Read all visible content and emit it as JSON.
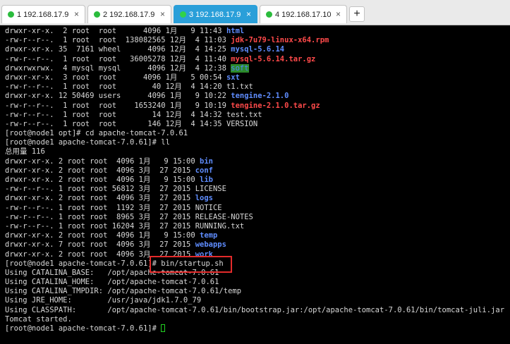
{
  "tabs": [
    {
      "label": "1 192.168.17.9",
      "active": false
    },
    {
      "label": "2 192.168.17.9",
      "active": false
    },
    {
      "label": "3 192.168.17.9",
      "active": true
    },
    {
      "label": "4 192.168.17.10",
      "active": false
    }
  ],
  "add_tab_label": "+",
  "terminal": {
    "lines": [
      {
        "text": "drwxr-xr-x.  2 root  root      4096 1月   9 11:43 ",
        "name": "html",
        "cls": "dir"
      },
      {
        "text": "-rw-r--r--.  1 root  root  138082565 12月  4 11:03 ",
        "name": "jdk-7u79-linux-x64.rpm",
        "cls": "red"
      },
      {
        "text": "drwxr-xr-x. 35  7161 wheel      4096 12月  4 14:25 ",
        "name": "mysql-5.6.14",
        "cls": "dir"
      },
      {
        "text": "-rw-r--r--.  1 root  root   36005278 12月  4 11:40 ",
        "name": "mysql-5.6.14.tar.gz",
        "cls": "red"
      },
      {
        "text": "drwxrwxrwx.  4 mysql mysql      4096 12月  4 12:38 ",
        "name": "soft",
        "cls": "softbg"
      },
      {
        "text": "drwxr-xr-x.  3 root  root      4096 1月   5 00:54 ",
        "name": "sxt",
        "cls": "dir"
      },
      {
        "text": "-rw-r--r--.  1 root  root        40 12月  4 14:20 ",
        "name": "t1.txt",
        "cls": ""
      },
      {
        "text": "drwxr-xr-x. 12 50469 users      4096 1月   9 10:22 ",
        "name": "tengine-2.1.0",
        "cls": "dir"
      },
      {
        "text": "-rw-r--r--.  1 root  root    1653240 1月   9 10:19 ",
        "name": "tengine-2.1.0.tar.gz",
        "cls": "red"
      },
      {
        "text": "-rw-r--r--.  1 root  root        14 12月  4 14:32 ",
        "name": "test.txt",
        "cls": ""
      },
      {
        "text": "-rw-r--r--.  1 root  root       146 12月  4 14:35 ",
        "name": "VERSION",
        "cls": ""
      },
      {
        "text": "[root@node1 opt]# cd apache-tomcat-7.0.61",
        "name": "",
        "cls": ""
      },
      {
        "text": "[root@node1 apache-tomcat-7.0.61]# ll",
        "name": "",
        "cls": ""
      },
      {
        "text": "总用量 116",
        "name": "",
        "cls": ""
      },
      {
        "text": "drwxr-xr-x. 2 root root  4096 1月   9 15:00 ",
        "name": "bin",
        "cls": "dir"
      },
      {
        "text": "drwxr-xr-x. 2 root root  4096 3月  27 2015 ",
        "name": "conf",
        "cls": "dir"
      },
      {
        "text": "drwxr-xr-x. 2 root root  4096 1月   9 15:00 ",
        "name": "lib",
        "cls": "dir"
      },
      {
        "text": "-rw-r--r--. 1 root root 56812 3月  27 2015 ",
        "name": "LICENSE",
        "cls": ""
      },
      {
        "text": "drwxr-xr-x. 2 root root  4096 3月  27 2015 ",
        "name": "logs",
        "cls": "dir"
      },
      {
        "text": "-rw-r--r--. 1 root root  1192 3月  27 2015 ",
        "name": "NOTICE",
        "cls": ""
      },
      {
        "text": "-rw-r--r--. 1 root root  8965 3月  27 2015 ",
        "name": "RELEASE-NOTES",
        "cls": ""
      },
      {
        "text": "-rw-r--r--. 1 root root 16204 3月  27 2015 ",
        "name": "RUNNING.txt",
        "cls": ""
      },
      {
        "text": "drwxr-xr-x. 2 root root  4096 1月   9 15:00 ",
        "name": "temp",
        "cls": "dir"
      },
      {
        "text": "drwxr-xr-x. 7 root root  4096 3月  27 2015 ",
        "name": "webapps",
        "cls": "dir"
      },
      {
        "text": "drwxr-xr-x. 2 root root  4096 3月  27 2015 ",
        "name": "work",
        "cls": "dir"
      },
      {
        "text": "[root@node1 apache-tomcat-7.0.61]# bin/startup.sh",
        "name": "",
        "cls": ""
      },
      {
        "text": "Using CATALINA_BASE:   /opt/apache-tomcat-7.0.61",
        "name": "",
        "cls": ""
      },
      {
        "text": "Using CATALINA_HOME:   /opt/apache-tomcat-7.0.61",
        "name": "",
        "cls": ""
      },
      {
        "text": "Using CATALINA_TMPDIR: /opt/apache-tomcat-7.0.61/temp",
        "name": "",
        "cls": ""
      },
      {
        "text": "Using JRE_HOME:        /usr/java/jdk1.7.0_79",
        "name": "",
        "cls": ""
      },
      {
        "text": "Using CLASSPATH:       /opt/apache-tomcat-7.0.61/bin/bootstrap.jar:/opt/apache-tomcat-7.0.61/bin/tomcat-juli.jar",
        "name": "",
        "cls": ""
      },
      {
        "text": "Tomcat started.",
        "name": "",
        "cls": ""
      }
    ],
    "prompt": "[root@node1 apache-tomcat-7.0.61]# "
  },
  "colors": {
    "tab_active_bg": "#2a9fd9",
    "status_dot": "#2bbc3d",
    "directory": "#5f8dff",
    "archive": "#ff4a4a",
    "highlight_box": "#e32b2b",
    "cursor": "#22d422"
  }
}
